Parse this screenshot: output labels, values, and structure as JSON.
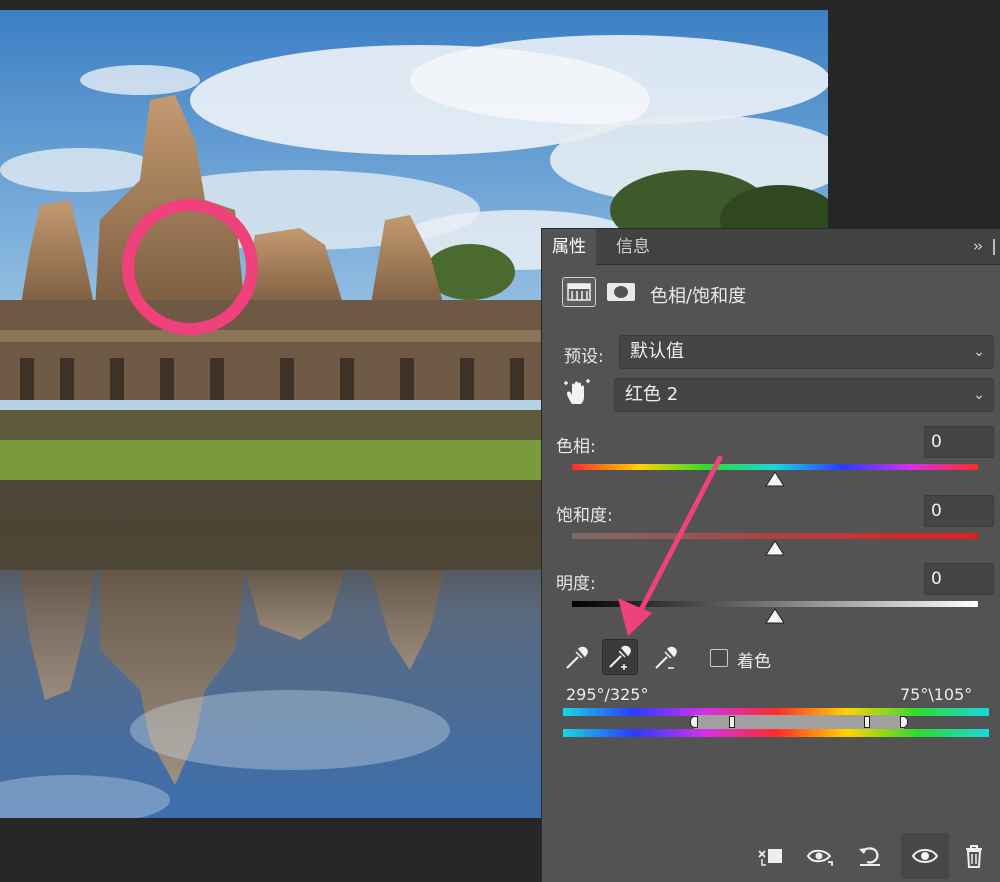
{
  "panel": {
    "tabs": [
      {
        "label": "属性",
        "active": true
      },
      {
        "label": "信息",
        "active": false
      }
    ],
    "collapse_label": "››",
    "adjustment": {
      "title": "色相/饱和度",
      "icons": [
        "adjustment-layer-icon",
        "layer-mask-icon"
      ]
    },
    "preset": {
      "label": "预设:",
      "value": "默认值"
    },
    "channel": {
      "icon": "on-image-adjust-hand-icon",
      "value": "红色 2"
    },
    "hue": {
      "label": "色相:",
      "value": "0",
      "level": 0
    },
    "saturation": {
      "label": "饱和度:",
      "value": "0",
      "level": 0
    },
    "lightness": {
      "label": "明度:",
      "value": "0",
      "level": 0
    },
    "eyedroppers": [
      "eyedropper-icon",
      "eyedropper-add-icon",
      "eyedropper-subtract-icon"
    ],
    "colorize": {
      "label": "着色",
      "checked": false
    },
    "range": {
      "left_label": "295°/325°",
      "right_label": "75°\\105°"
    },
    "bottom_icons": [
      "clip-to-layer-icon",
      "view-previous-state-icon",
      "reset-icon",
      "visibility-eye-icon",
      "delete-trash-icon"
    ]
  },
  "annotation": {
    "circle_color": "#f0417d",
    "arrow_color": "#f0417d"
  },
  "colors": {
    "panel_bg": "#535353",
    "tabbar_bg": "#424242",
    "app_bg": "#262626",
    "field_bg": "#454545"
  }
}
